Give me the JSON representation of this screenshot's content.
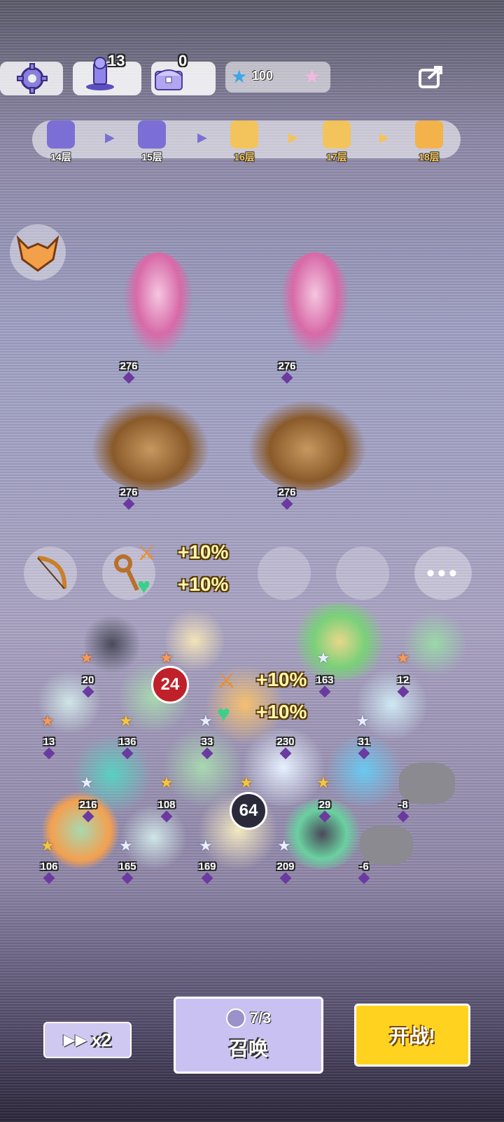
{
  "top_bar": {
    "trophy_count": "13",
    "chest_count": "0",
    "star_currency": "100"
  },
  "floors": [
    {
      "label": "14层",
      "state": "cleared"
    },
    {
      "label": "15层",
      "state": "cleared"
    },
    {
      "label": "16层",
      "state": "current"
    },
    {
      "label": "17层",
      "state": "upcoming"
    },
    {
      "label": "18层",
      "state": "reward"
    }
  ],
  "enemies": [
    {
      "name": "lady-enemy",
      "level": "276"
    },
    {
      "name": "lady-enemy",
      "level": "276"
    },
    {
      "name": "catfish-enemy",
      "level": "276"
    },
    {
      "name": "catfish-enemy",
      "level": "276"
    }
  ],
  "synergy": [
    {
      "icon": "attack-buff-icon",
      "value": "+10%"
    },
    {
      "icon": "heart-buff-icon",
      "value": "+10%"
    }
  ],
  "field_buffs": [
    {
      "value": "+10%"
    },
    {
      "value": "+10%"
    }
  ],
  "big_numbers": [
    "24",
    "64"
  ],
  "hero_levels": [
    "20",
    "163",
    "12",
    "13",
    "136",
    "33",
    "230",
    "31",
    "216",
    "108",
    "29",
    "-8",
    "106",
    "165",
    "169",
    "209",
    "-6"
  ],
  "controls": {
    "speed_label": "x2",
    "summon_cost": "7/3",
    "summon_label": "召唤",
    "start_label": "开战!"
  },
  "colors": {
    "start_button": "#ffd21f",
    "summon_button": "#c9c1f2",
    "speed_button": "#cfc8f0",
    "level_diamond": "#6b3aa0"
  }
}
